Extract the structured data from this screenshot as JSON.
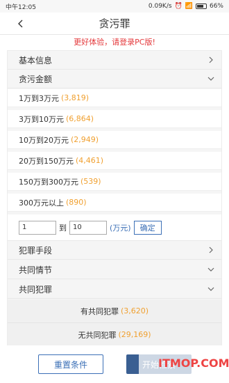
{
  "status_bar": {
    "time": "中午12:05",
    "speed": "0.09K/s",
    "battery": "66%"
  },
  "nav": {
    "title": "贪污罪"
  },
  "notice": "更好体验，请登录PC版!",
  "sections": {
    "basic_info": "基本信息",
    "amount": "贪污金额",
    "method": "犯罪手段",
    "joint_plot": "共同情节",
    "joint_crime": "共同犯罪"
  },
  "amount_options": [
    {
      "label": "1万到3万元",
      "count": "(3,819)"
    },
    {
      "label": "3万到10万元",
      "count": "(6,864)"
    },
    {
      "label": "10万到20万元",
      "count": "(2,949)"
    },
    {
      "label": "20万到150万元",
      "count": "(4,461)"
    },
    {
      "label": "150万到300万元",
      "count": "(539)"
    },
    {
      "label": "300万元以上",
      "count": "(890)"
    }
  ],
  "range": {
    "from": "1",
    "to_label": "到",
    "to": "10",
    "unit": "(万元)",
    "confirm": "确定"
  },
  "joint_crime_options": [
    {
      "label": "有共同犯罪",
      "count": "(3,620)"
    },
    {
      "label": "无共同犯罪",
      "count": "(29,169)"
    }
  ],
  "buttons": {
    "reset": "重置条件",
    "search": "开始检索"
  },
  "watermark": "ITMOP.COM",
  "colors": {
    "accent": "#3b6fb6",
    "count": "#f0a030",
    "notice": "#e4393c"
  }
}
